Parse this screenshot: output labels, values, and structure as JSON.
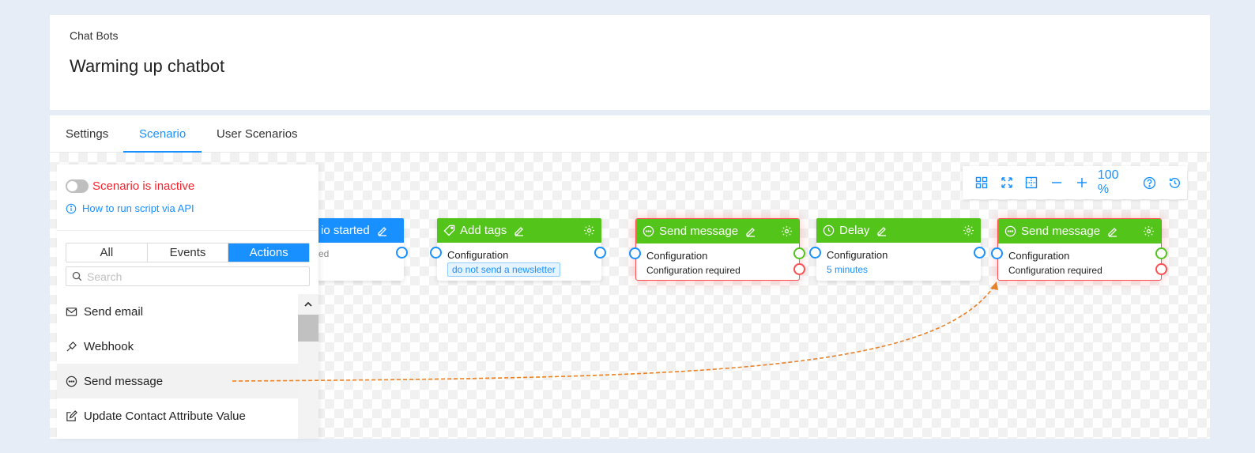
{
  "header": {
    "breadcrumb": "Chat Bots",
    "title": "Warming up chatbot"
  },
  "tabs": {
    "settings": "Settings",
    "scenario": "Scenario",
    "user_scenarios": "User Scenarios"
  },
  "toolbar": {
    "zoom": "100 %"
  },
  "panel": {
    "status": "Scenario is inactive",
    "api_link": "How to run script via API",
    "filters": {
      "all": "All",
      "events": "Events",
      "actions": "Actions"
    },
    "search_placeholder": "Search",
    "items": [
      "Send email",
      "Webhook",
      "Send message",
      "Update Contact Attribute Value"
    ]
  },
  "nodes": {
    "start": {
      "title": "io started",
      "sub": "ed"
    },
    "add_tags": {
      "title": "Add tags",
      "config": "Configuration",
      "tag": "do not send a newsletter"
    },
    "send1": {
      "title": "Send message",
      "config": "Configuration",
      "note": "Configuration required"
    },
    "delay": {
      "title": "Delay",
      "config": "Configuration",
      "value": "5 minutes"
    },
    "send2": {
      "title": "Send message",
      "config": "Configuration",
      "note": "Configuration required"
    }
  },
  "colors": {
    "accent": "#1890ff",
    "action": "#52c41a",
    "error": "#ff4d4f",
    "drag_line": "#e8822a"
  }
}
